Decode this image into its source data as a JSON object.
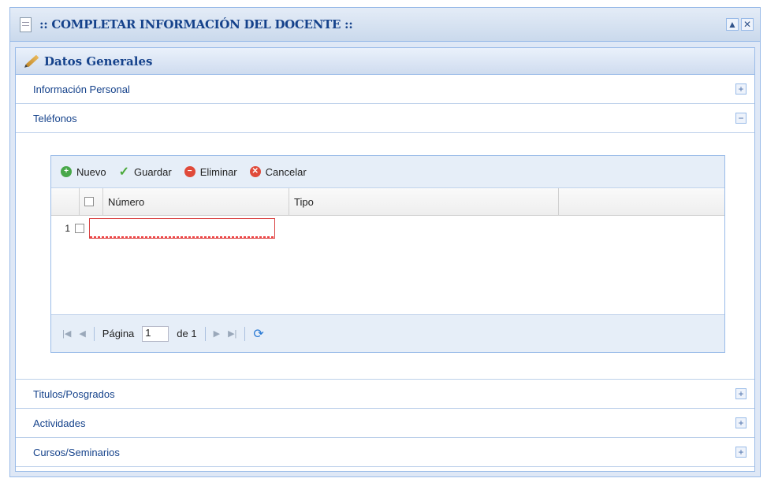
{
  "window": {
    "title": ":: COMPLETAR INFORMACIÓN DEL DOCENTE ::",
    "collapse_icon": "▲",
    "close_icon": "✕"
  },
  "section": {
    "title": "Datos Generales"
  },
  "accordion": [
    {
      "label": "Información Personal",
      "state": "+"
    },
    {
      "label": "Teléfonos",
      "state": "−"
    },
    {
      "label": "Titulos/Posgrados",
      "state": "+"
    },
    {
      "label": "Actividades",
      "state": "+"
    },
    {
      "label": "Cursos/Seminarios",
      "state": "+"
    }
  ],
  "grid": {
    "toolbar": {
      "new": "Nuevo",
      "save": "Guardar",
      "delete": "Eliminar",
      "cancel": "Cancelar"
    },
    "columns": {
      "numero": "Número",
      "tipo": "Tipo"
    },
    "rows": [
      {
        "num": "1",
        "numero": "",
        "tipo": ""
      }
    ],
    "pager": {
      "page_label": "Página",
      "page_value": "1",
      "of_label": "de 1"
    }
  }
}
